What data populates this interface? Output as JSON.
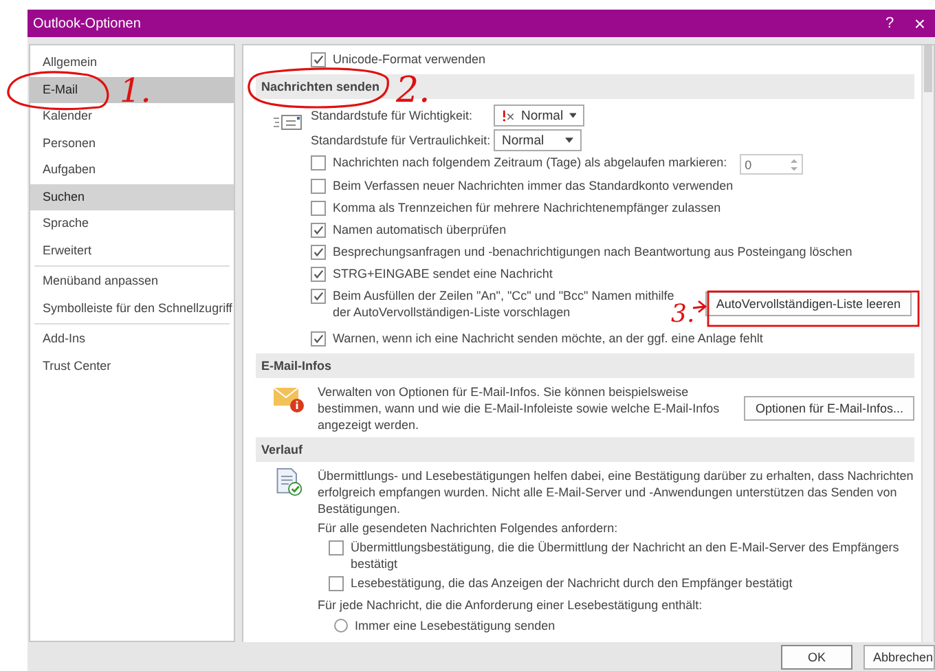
{
  "window": {
    "title": "Outlook-Optionen",
    "help": "?",
    "close": "×"
  },
  "sidebar": {
    "groups": [
      [
        {
          "label": "Allgemein",
          "selected": false,
          "hovered": false
        },
        {
          "label": "E-Mail",
          "selected": true,
          "hovered": false,
          "annotation": "1."
        },
        {
          "label": "Kalender",
          "selected": false,
          "hovered": false
        },
        {
          "label": "Personen",
          "selected": false,
          "hovered": false
        },
        {
          "label": "Aufgaben",
          "selected": false,
          "hovered": false
        },
        {
          "label": "Suchen",
          "selected": false,
          "hovered": true
        },
        {
          "label": "Sprache",
          "selected": false,
          "hovered": false
        },
        {
          "label": "Erweitert",
          "selected": false,
          "hovered": false
        }
      ],
      [
        {
          "label": "Menüband anpassen",
          "selected": false,
          "hovered": false
        },
        {
          "label": "Symbolleiste für den Schnellzugriff",
          "selected": false,
          "hovered": false
        }
      ],
      [
        {
          "label": "Add-Ins",
          "selected": false,
          "hovered": false
        },
        {
          "label": "Trust Center",
          "selected": false,
          "hovered": false
        }
      ]
    ]
  },
  "top_option": {
    "label": "Unicode-Format verwenden",
    "checked": true
  },
  "send_section": {
    "title": "Nachrichten senden",
    "importance": {
      "label": "Standardstufe für Wichtigkeit:",
      "value": "Normal"
    },
    "sensitivity": {
      "label": "Standardstufe für Vertraulichkeit:",
      "value": "Normal"
    },
    "options": [
      {
        "kind": "spin",
        "label": "Nachrichten nach folgendem Zeitraum (Tage) als abgelaufen markieren:",
        "checked": false,
        "value": "0"
      },
      {
        "kind": "check",
        "label": "Beim Verfassen neuer Nachrichten immer das Standardkonto verwenden",
        "checked": false
      },
      {
        "kind": "check",
        "label": "Komma als Trennzeichen für mehrere Nachrichtenempfänger zulassen",
        "checked": false
      },
      {
        "kind": "check",
        "label": "Namen automatisch überprüfen",
        "checked": true
      },
      {
        "kind": "check",
        "label": "Besprechungsanfragen und -benachrichtigungen nach Beantwortung aus Posteingang löschen",
        "checked": true
      },
      {
        "kind": "check",
        "label": "STRG+EINGABE sendet eine Nachricht",
        "checked": true
      },
      {
        "kind": "button",
        "label": "Beim Ausfüllen der Zeilen \"An\", \"Cc\" und \"Bcc\" Namen mithilfe der AutoVervollständigen-Liste vorschlagen",
        "checked": true,
        "button": "AutoVervollständigen-Liste leeren"
      },
      {
        "kind": "check",
        "label": "Warnen, wenn ich eine Nachricht senden möchte, an der ggf. eine Anlage fehlt",
        "checked": true
      }
    ]
  },
  "infos": {
    "title": "E-Mail-Infos",
    "text": "Verwalten von Optionen für E-Mail-Infos. Sie können beispielsweise bestimmen, wann und wie die E-Mail-Infoleiste sowie welche E-Mail-Infos angezeigt werden.",
    "button": "Optionen für E-Mail-Infos..."
  },
  "history": {
    "title": "Verlauf",
    "text": "Übermittlungs- und Lesebestätigungen helfen dabei, eine Bestätigung darüber zu erhalten, dass Nachrichten erfolgreich empfangen wurden. Nicht alle E-Mail-Server und -Anwendungen unterstützen das Senden von Bestätigungen.",
    "request_label": "Für alle gesendeten Nachrichten Folgendes anfordern:",
    "requests": [
      {
        "label": "Übermittlungsbestätigung, die die Übermittlung der Nachricht an den E-Mail-Server des Empfängers bestätigt",
        "checked": false
      },
      {
        "label": "Lesebestätigung, die das Anzeigen der Nachricht durch den Empfänger bestätigt",
        "checked": false
      }
    ],
    "reply_label": "Für jede Nachricht, die die Anforderung einer Lesebestätigung enthält:",
    "replies": [
      {
        "label": "Immer eine Lesebestätigung senden",
        "selected": false
      }
    ]
  },
  "footer": {
    "buttons": [
      "OK",
      "Abbrechen"
    ]
  },
  "annotations": [
    "2.",
    "3."
  ]
}
